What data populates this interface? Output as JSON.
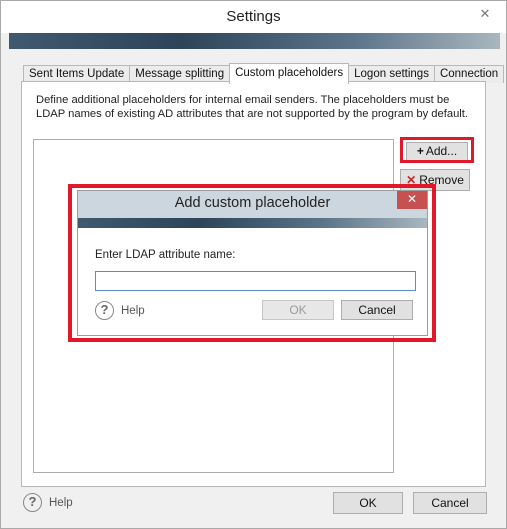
{
  "window": {
    "title": "Settings",
    "close_glyph": "✕"
  },
  "tabs": [
    {
      "label": "Sent Items Update",
      "active": false
    },
    {
      "label": "Message splitting",
      "active": false
    },
    {
      "label": "Custom placeholders",
      "active": true
    },
    {
      "label": "Logon settings",
      "active": false
    },
    {
      "label": "Connection",
      "active": false
    }
  ],
  "panel": {
    "description": "Define additional placeholders for internal email senders. The placeholders must be LDAP names of existing AD attributes that are not supported by the program by default.",
    "add_label": "Add...",
    "add_icon": "+",
    "remove_label": "Remove",
    "remove_icon": "✕"
  },
  "footer": {
    "help_label": "Help",
    "help_icon": "?",
    "ok_label": "OK",
    "cancel_label": "Cancel"
  },
  "dialog": {
    "title": "Add custom placeholder",
    "close_glyph": "✕",
    "field_label": "Enter LDAP attribute name:",
    "field_value": "",
    "help_label": "Help",
    "help_icon": "?",
    "ok_label": "OK",
    "cancel_label": "Cancel"
  },
  "colors": {
    "highlight": "#e0182a",
    "banner": "#2d4459"
  }
}
